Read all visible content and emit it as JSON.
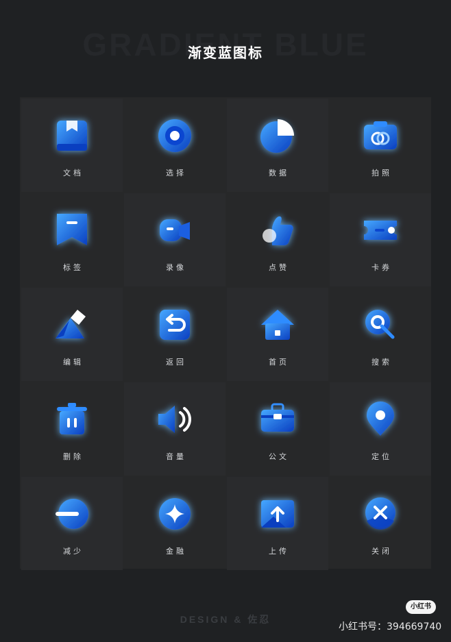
{
  "header": {
    "bg_title": "GRADIENT BLUE",
    "title": "渐变蓝图标"
  },
  "icons": [
    {
      "label": "文档",
      "icon": "document-icon"
    },
    {
      "label": "选择",
      "icon": "select-icon"
    },
    {
      "label": "数据",
      "icon": "data-icon"
    },
    {
      "label": "拍照",
      "icon": "camera-icon"
    },
    {
      "label": "标签",
      "icon": "tag-icon"
    },
    {
      "label": "录像",
      "icon": "video-icon"
    },
    {
      "label": "点赞",
      "icon": "like-icon"
    },
    {
      "label": "卡券",
      "icon": "coupon-icon"
    },
    {
      "label": "编辑",
      "icon": "edit-icon"
    },
    {
      "label": "返回",
      "icon": "back-icon"
    },
    {
      "label": "首页",
      "icon": "home-icon"
    },
    {
      "label": "搜索",
      "icon": "search-icon"
    },
    {
      "label": "删除",
      "icon": "delete-icon"
    },
    {
      "label": "音量",
      "icon": "volume-icon"
    },
    {
      "label": "公文",
      "icon": "briefcase-icon"
    },
    {
      "label": "定位",
      "icon": "location-icon"
    },
    {
      "label": "减少",
      "icon": "minus-icon"
    },
    {
      "label": "金融",
      "icon": "finance-icon"
    },
    {
      "label": "上传",
      "icon": "upload-icon"
    },
    {
      "label": "关闭",
      "icon": "close-icon"
    }
  ],
  "footer": {
    "credit": "DESIGN & 佐忍"
  },
  "watermark": {
    "badge": "小红书",
    "account": "小红书号：394669740"
  },
  "colors": {
    "background": "#1f2123",
    "panel": "#272829",
    "blue_light": "#3fa0ff",
    "blue_dark": "#0a3fc0",
    "text": "#d6d8db"
  }
}
